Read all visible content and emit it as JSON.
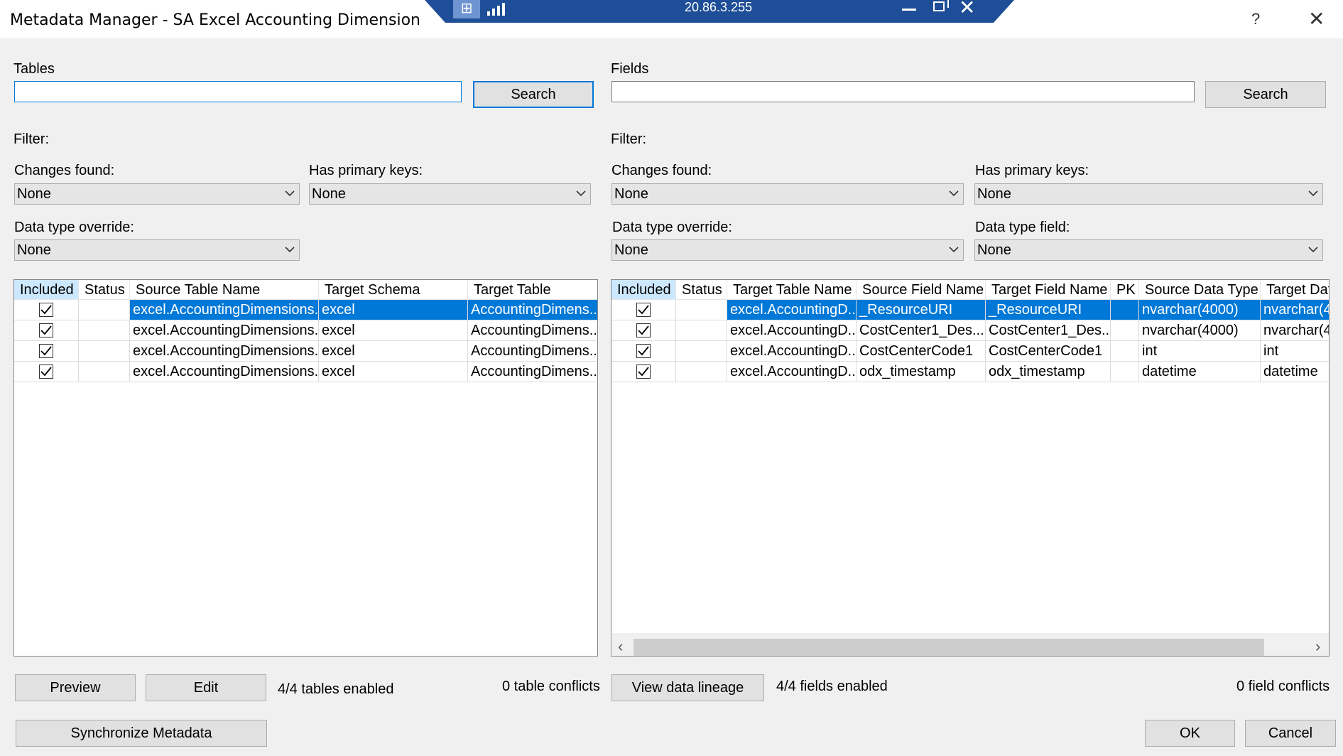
{
  "window": {
    "title": "Metadata Manager - SA Excel Accounting Dimension",
    "help": "?",
    "close": "✕"
  },
  "rdp": {
    "ip": "20.86.3.255"
  },
  "left": {
    "tables_label": "Tables",
    "search_value": "",
    "search_button": "Search",
    "filter_label": "Filter:",
    "changes_label": "Changes found:",
    "changes_value": "None",
    "pk_label": "Has primary keys:",
    "pk_value": "None",
    "dto_label": "Data type override:",
    "dto_value": "None",
    "columns": [
      "Included",
      "Status",
      "Source Table Name",
      "Target Schema",
      "Target Table"
    ],
    "rows": [
      {
        "included": true,
        "status": "",
        "source": "excel.AccountingDimensions...",
        "schema": "excel",
        "target": "AccountingDimens..."
      },
      {
        "included": true,
        "status": "",
        "source": "excel.AccountingDimensions...",
        "schema": "excel",
        "target": "AccountingDimens..."
      },
      {
        "included": true,
        "status": "",
        "source": "excel.AccountingDimensions...",
        "schema": "excel",
        "target": "AccountingDimens..."
      },
      {
        "included": true,
        "status": "",
        "source": "excel.AccountingDimensions...",
        "schema": "excel",
        "target": "AccountingDimens..."
      }
    ],
    "preview_button": "Preview",
    "edit_button": "Edit",
    "enabled_text": "4/4 tables enabled",
    "conflicts_text": "0 table conflicts",
    "sync_button": "Synchronize Metadata"
  },
  "right": {
    "fields_label": "Fields",
    "search_value": "",
    "search_button": "Search",
    "filter_label": "Filter:",
    "changes_label": "Changes found:",
    "changes_value": "None",
    "pk_label": "Has primary keys:",
    "pk_value": "None",
    "dto_label": "Data type override:",
    "dto_value": "None",
    "dtf_label": "Data type field:",
    "dtf_value": "None",
    "columns": [
      "Included",
      "Status",
      "Target Table Name",
      "Source Field Name",
      "Target Field Name",
      "PK",
      "Source Data Type",
      "Target Dat"
    ],
    "rows": [
      {
        "included": true,
        "status": "",
        "table": "excel.AccountingD...",
        "source_field": "_ResourceURI",
        "target_field": "_ResourceURI",
        "pk": "",
        "source_type": "nvarchar(4000)",
        "target_type": "nvarchar(4("
      },
      {
        "included": true,
        "status": "",
        "table": "excel.AccountingD...",
        "source_field": "CostCenter1_Des...",
        "target_field": "CostCenter1_Des...",
        "pk": "",
        "source_type": "nvarchar(4000)",
        "target_type": "nvarchar(4("
      },
      {
        "included": true,
        "status": "",
        "table": "excel.AccountingD...",
        "source_field": "CostCenterCode1",
        "target_field": "CostCenterCode1",
        "pk": "",
        "source_type": "int",
        "target_type": "int"
      },
      {
        "included": true,
        "status": "",
        "table": "excel.AccountingD...",
        "source_field": "odx_timestamp",
        "target_field": "odx_timestamp",
        "pk": "",
        "source_type": "datetime",
        "target_type": "datetime"
      }
    ],
    "lineage_button": "View data lineage",
    "enabled_text": "4/4 fields enabled",
    "conflicts_text": "0 field conflicts",
    "ok_button": "OK",
    "cancel_button": "Cancel"
  }
}
